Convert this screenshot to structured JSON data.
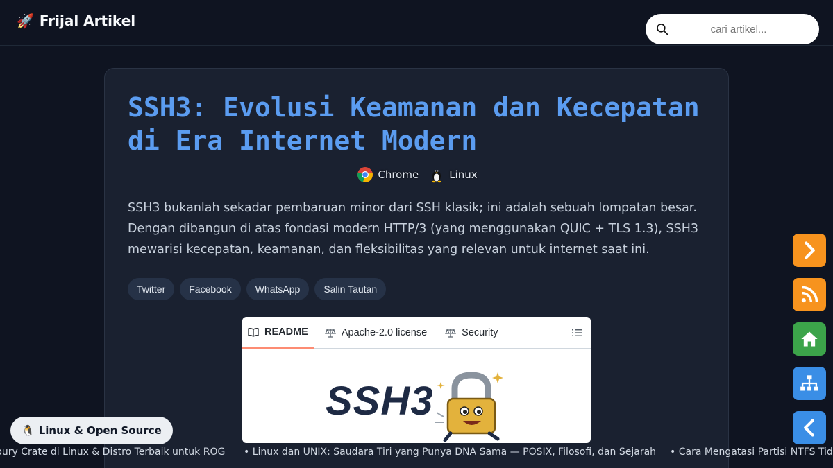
{
  "header": {
    "brand_icon": "rocket-icon",
    "brand_text": "Frijal Artikel",
    "search_placeholder": "cari artikel..."
  },
  "article": {
    "title": "SSH3: Evolusi Keamanan dan Kecepatan di Era Internet Modern",
    "tags": [
      {
        "label": "Chrome",
        "icon": "chrome-icon"
      },
      {
        "label": "Linux",
        "icon": "tux-icon"
      }
    ],
    "intro": "SSH3 bukanlah sekadar pembaruan minor dari SSH klasik; ini adalah sebuah lompatan besar. Dengan dibangun di atas fondasi modern HTTP/3 (yang menggunakan QUIC + TLS 1.3), SSH3 mewarisi kecepatan, keamanan, dan fleksibilitas yang relevan untuk internet saat ini.",
    "share": [
      "Twitter",
      "Facebook",
      "WhatsApp",
      "Salin Tautan"
    ]
  },
  "readme": {
    "tabs": [
      "README",
      "Apache-2.0 license",
      "Security"
    ],
    "logo_text": "SSH3"
  },
  "side_buttons": [
    {
      "name": "next-button",
      "icon": "chevron-right-icon",
      "color": "#f7931e"
    },
    {
      "name": "rss-button",
      "icon": "rss-icon",
      "color": "#f7931e"
    },
    {
      "name": "home-button",
      "icon": "home-icon",
      "color": "#3ca44a"
    },
    {
      "name": "sitemap-button",
      "icon": "sitemap-icon",
      "color": "#3a8ee6"
    },
    {
      "name": "prev-button",
      "icon": "chevron-left-icon",
      "color": "#3a8ee6"
    }
  ],
  "ticker": [
    "bury Crate di Linux & Distro Terbaik untuk ROG",
    "• Linux dan UNIX: Saudara Tiri yang Punya DNA Sama — POSIX, Filosofi, dan Sejarah",
    "• Cara Mengatasi Partisi NTFS Tida"
  ],
  "category_pill": "Linux & Open Source",
  "colors": {
    "background": "#0f1421",
    "card": "#1a2130",
    "title": "#5b9cf0",
    "orange": "#f7931e",
    "green": "#3ca44a",
    "blue": "#3a8ee6"
  }
}
